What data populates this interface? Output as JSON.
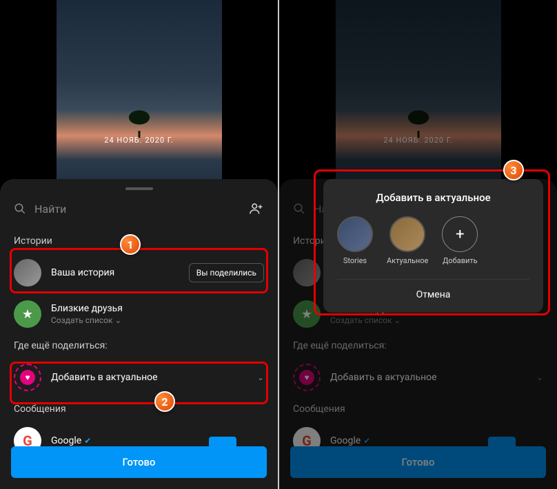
{
  "story": {
    "date_overlay": "24 НОЯБ. 2020 Г."
  },
  "sheet": {
    "search_placeholder": "Найти",
    "stories_label": "Истории",
    "your_story_label": "Ваша история",
    "shared_label": "Вы поделились",
    "close_friends_label": "Близкие друзья",
    "create_list_label": "Создать список",
    "where_else_label": "Где ещё поделиться:",
    "add_highlight_label": "Добавить в актуальное",
    "messages_label": "Сообщения",
    "google_label": "Google",
    "done_label": "Готово"
  },
  "dialog": {
    "title": "Добавить в актуальное",
    "highlights": [
      {
        "label": "Stories"
      },
      {
        "label": "Актуальное"
      },
      {
        "label": "Добавить"
      }
    ],
    "cancel_label": "Отмена"
  },
  "markers": {
    "m1": "1",
    "m2": "2",
    "m3": "3"
  }
}
